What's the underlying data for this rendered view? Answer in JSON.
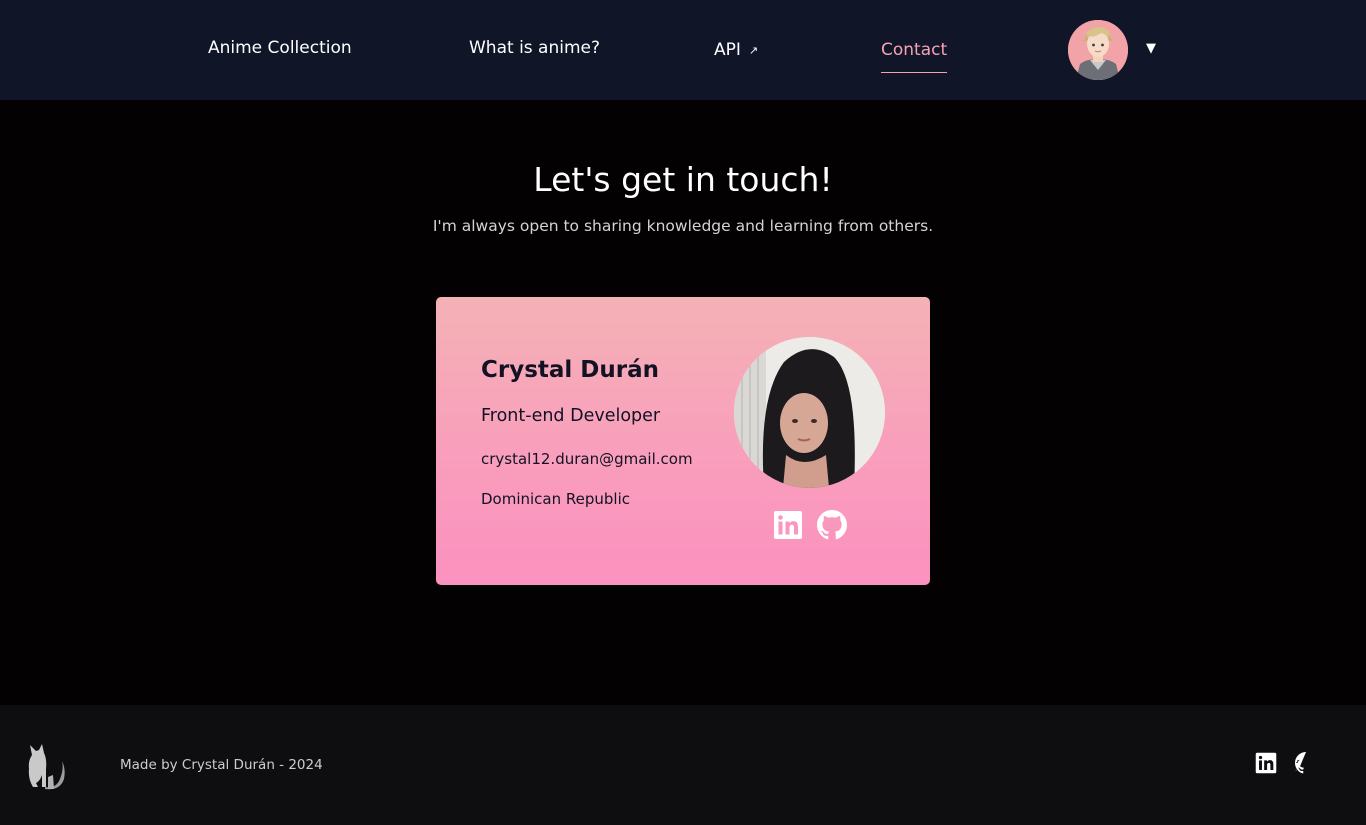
{
  "nav": {
    "items": [
      {
        "label": "Anime Collection"
      },
      {
        "label": "What is anime?"
      },
      {
        "label": "API",
        "external_icon": "↗"
      },
      {
        "label": "Contact",
        "active": true
      }
    ],
    "menu_caret": "▼",
    "active_color": "#f5a3b3"
  },
  "hero": {
    "title": "Let's get in touch!",
    "subtitle": "I'm always open to sharing knowledge and learning from others."
  },
  "card": {
    "name": "Crystal Durán",
    "role": "Front-end Developer",
    "email": "crystal12.duran@gmail.com",
    "country": "Dominican Republic",
    "social": [
      "linkedin-icon",
      "github-icon"
    ],
    "gradient": [
      "#f4b2b5",
      "#fb91bf"
    ]
  },
  "footer": {
    "credit": "Made by Crystal Durán - 2024",
    "social": [
      "linkedin-icon",
      "github-icon"
    ],
    "logo": "cat-logo-icon"
  },
  "colors": {
    "header_bg": "#101628",
    "page_bg": "#030102",
    "footer_bg": "#0e0d10"
  }
}
